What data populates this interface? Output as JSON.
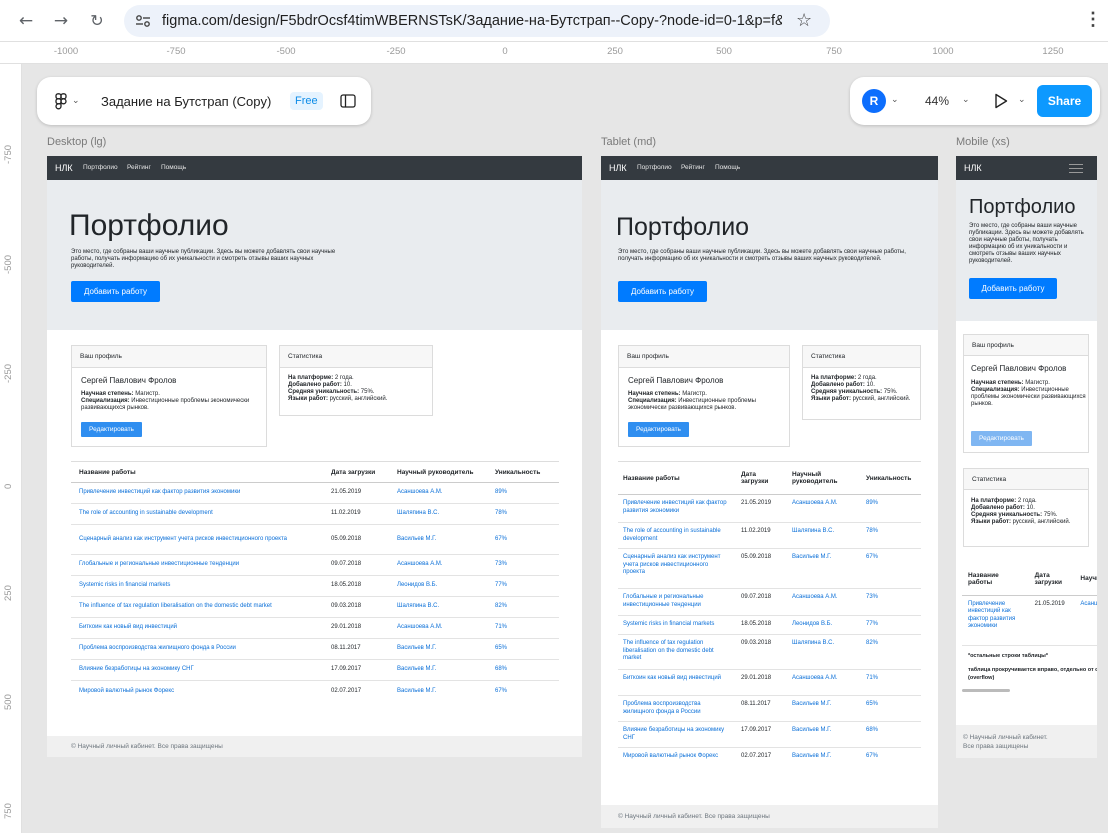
{
  "browser": {
    "url": "figma.com/design/F5bdrOcsf4timWBERNSTsK/Задание-на-Бутстрап--Copy-?node-id=0-1&p=f&t..."
  },
  "ruler": {
    "h": [
      "-1000",
      "-750",
      "-500",
      "-250",
      "0",
      "250",
      "500",
      "750",
      "1000",
      "1250"
    ],
    "v": [
      "-750",
      "-500",
      "-250",
      "0",
      "250",
      "500",
      "750"
    ]
  },
  "figma": {
    "file_title": "Задание на Бутстрап (Copy)",
    "plan_badge": "Free",
    "avatar": "R",
    "zoom": "44%",
    "share": "Share"
  },
  "frames": {
    "desktop": "Desktop (lg)",
    "tablet": "Tablet (md)",
    "mobile": "Mobile (xs)"
  },
  "site": {
    "brand": "НЛК",
    "nav": [
      "Портфолио",
      "Рейтинг",
      "Помощь"
    ],
    "hero_title": "Портфолио",
    "hero_lead": "Это место, где собраны ваши научные публикации. Здесь вы можете добавлять свои научные работы, получать информацию об их уникальности и смотреть отзывы ваших научных руководителей.",
    "add_button": "Добавить работу",
    "profile": {
      "header": "Ваш профиль",
      "name": "Сергей Павлович Фролов",
      "degree_label": "Научная степень:",
      "degree": "Магистр.",
      "spec_label": "Специализация:",
      "spec": "Инвестиционные проблемы экономически развивающихся рынков.",
      "edit": "Редактировать"
    },
    "stats": {
      "header": "Статистика",
      "r1_label": "На платформе:",
      "r1": "2 года.",
      "r2_label": "Добавлено работ:",
      "r2": "10.",
      "r3_label": "Средняя уникальность:",
      "r3": "75%.",
      "r4_label": "Языки работ:",
      "r4": "русский, английский."
    },
    "table": {
      "headers": [
        "Название работы",
        "Дата загрузки",
        "Научный руководитель",
        "Уникальность"
      ],
      "rows": [
        [
          "Привлечение инвестиций как фактор развития экономики",
          "21.05.2019",
          "Асаншоева А.М.",
          "89%"
        ],
        [
          "The role of accounting in sustainable development",
          "11.02.2019",
          "Шаляпина В.С.",
          "78%"
        ],
        [
          "Сценарный анализ как инструмент учета рисков инвестиционного проекта",
          "05.09.2018",
          "Васильев М.Г.",
          "67%"
        ],
        [
          "Глобальные и региональные инвестиционные тенденции",
          "09.07.2018",
          "Асаншоева А.М.",
          "73%"
        ],
        [
          "Systemic risks in financial markets",
          "18.05.2018",
          "Леонидов В.Б.",
          "77%"
        ],
        [
          "The influence of tax regulation liberalisation on the domestic debt market",
          "09.03.2018",
          "Шаляпина В.С.",
          "82%"
        ],
        [
          "Биткоин как новый вид инвестиций",
          "29.01.2018",
          "Асаншоева А.М.",
          "71%"
        ],
        [
          "Проблема воспроизводства жилищного фонда в России",
          "08.11.2017",
          "Васильев М.Г.",
          "65%"
        ],
        [
          "Влияние безработицы на экономику СНГ",
          "17.09.2017",
          "Васильев М.Г.",
          "68%"
        ],
        [
          "Мировой валютный рынок Форекс",
          "02.07.2017",
          "Васильев М.Г.",
          "67%"
        ]
      ]
    },
    "footer": "© Научный личный кабинет. Все права защищены",
    "footer_l1": "© Научный личный кабинет.",
    "footer_l2": "Все права защищены",
    "mobile_note1": "*остальные строки таблицы*",
    "mobile_note2": "таблица прокручивается вправо, отдельно от страницы (overflow)",
    "mobile_h_partial": "Научн"
  }
}
